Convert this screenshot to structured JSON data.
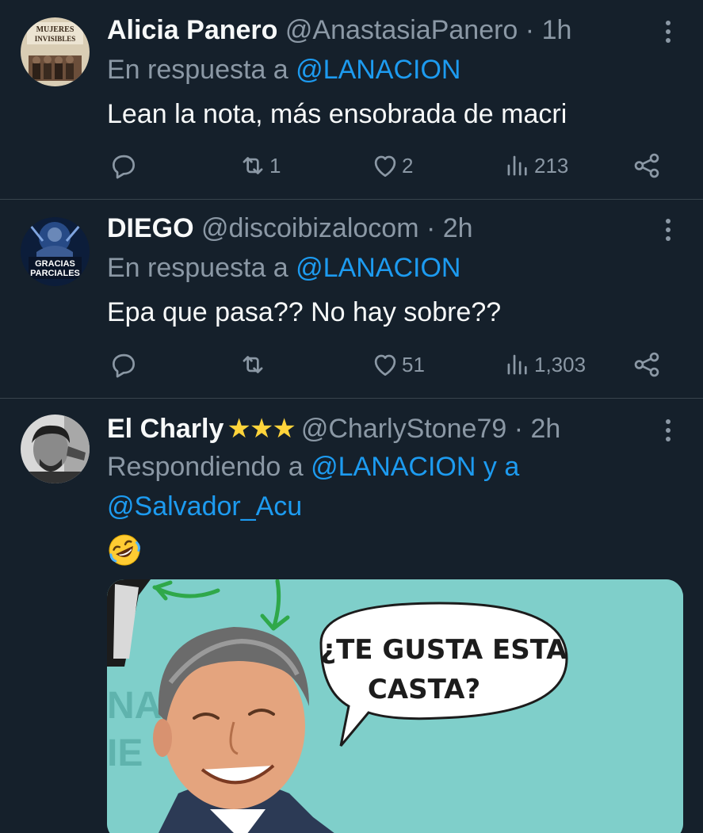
{
  "tweets": [
    {
      "author": "Alicia Panero",
      "handle": "@AnastasiaPanero",
      "time": "· 1h",
      "reply_prefix": "En respuesta a ",
      "reply_to": "@LANACION",
      "text": "Lean la nota, más ensobrada de macri",
      "avatar_text_1": "MUJERES",
      "avatar_text_2": "INVISIBLES",
      "retweets": "1",
      "likes": "2",
      "views": "213"
    },
    {
      "author": "DIEGO",
      "handle": "@discoibizalocom",
      "time": "· 2h",
      "reply_prefix": "En respuesta a ",
      "reply_to": "@LANACION",
      "text": "Epa que pasa?? No hay sobre??",
      "avatar_text_1": "GRACIAS",
      "avatar_text_2": "PARCIALES",
      "retweets": "",
      "likes": "51",
      "views": "1,303"
    },
    {
      "author": "El Charly",
      "stars": "★★★",
      "handle": "@CharlyStone79",
      "time": "· 2h",
      "reply_prefix": "Respondiendo a ",
      "reply_to": "@LANACION",
      "reply_and": " y a",
      "reply_to_2": "@Salvador_Acu",
      "speech_line_1": "¿TE GUSTA ESTA",
      "speech_line_2": "CASTA?"
    }
  ],
  "colors": {
    "background": "#15202b",
    "divider": "#38444d",
    "secondary_text": "#8b98a5",
    "link": "#1d9bf0",
    "star": "#ffd43b"
  },
  "icons": [
    "reply-icon",
    "retweet-icon",
    "like-icon",
    "views-icon",
    "share-icon",
    "more-icon"
  ]
}
